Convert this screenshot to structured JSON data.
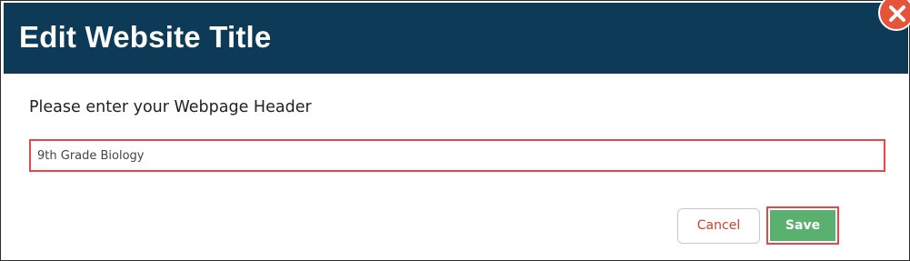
{
  "dialog": {
    "title": "Edit Website Title",
    "close_icon": "close-icon",
    "prompt": "Please enter your Webpage Header",
    "field": {
      "value": "9th Grade Biology",
      "placeholder": ""
    },
    "buttons": {
      "cancel": "Cancel",
      "save": "Save"
    }
  },
  "colors": {
    "header_bg": "#0d3a57",
    "close_bg": "#e5533b",
    "highlight": "#e5474b",
    "cancel_text": "#d0402c",
    "save_bg": "#5ab06e"
  }
}
